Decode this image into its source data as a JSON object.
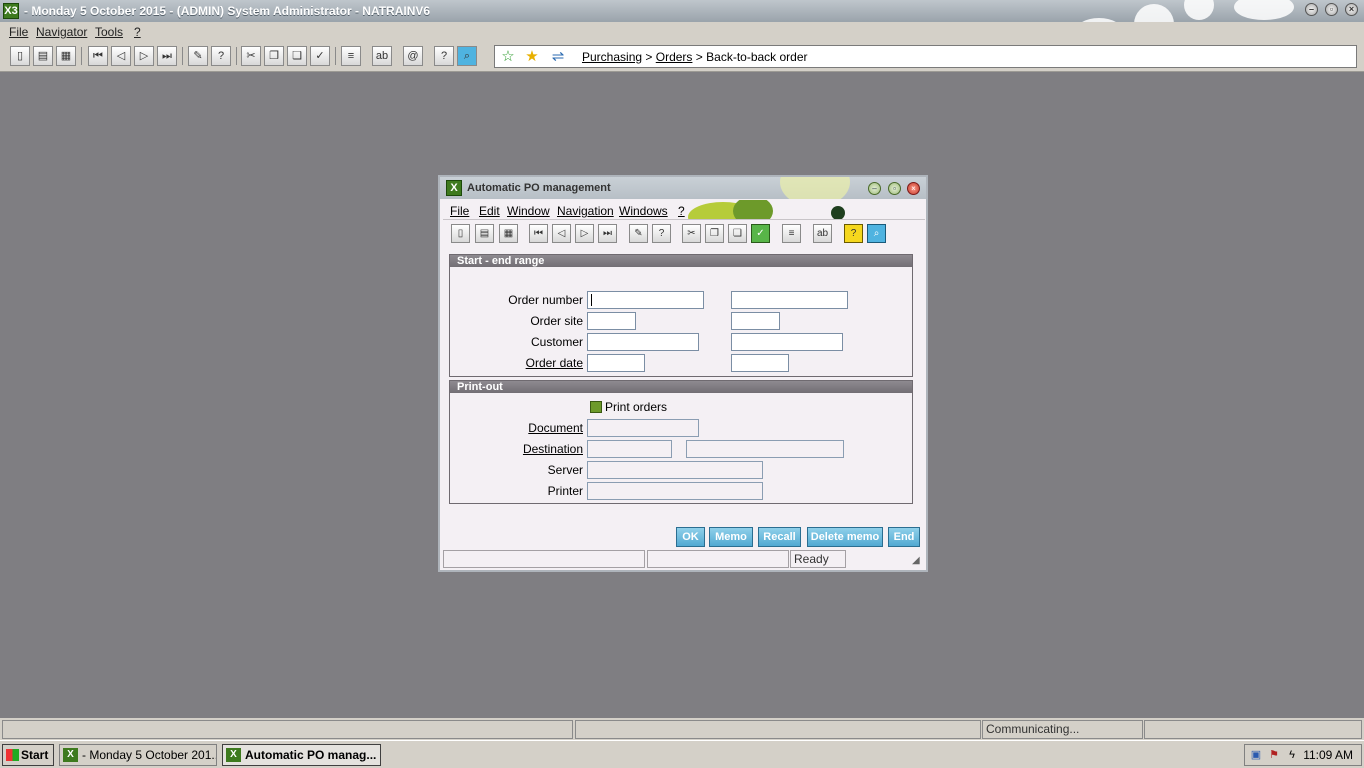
{
  "app": {
    "title": "- Monday 5 October 2015 - (ADMIN) System Administrator - NATRAINV6",
    "logo": "X3",
    "menu": [
      "File",
      "Navigator",
      "Tools",
      "?"
    ],
    "breadcrumb": {
      "items": [
        "Purchasing",
        "Orders",
        "Back-to-back order"
      ],
      "sep": ">"
    }
  },
  "window": {
    "title": "Automatic PO management",
    "menu": [
      "File",
      "Edit",
      "Window",
      "Navigation",
      "Windows",
      "?"
    ],
    "range_group": {
      "header": "Start - end range",
      "labels": {
        "order_number": "Order number",
        "order_site": "Order site",
        "customer": "Customer",
        "order_date": "Order date"
      },
      "values": {
        "order_number_from": "",
        "order_number_to": "",
        "order_site_from": "",
        "order_site_to": "",
        "customer_from": "",
        "customer_to": "",
        "order_date_from": "",
        "order_date_to": ""
      }
    },
    "print_group": {
      "header": "Print-out",
      "print_orders_label": "Print orders",
      "print_orders_checked": true,
      "labels": {
        "document": "Document",
        "destination": "Destination",
        "server": "Server",
        "printer": "Printer"
      },
      "values": {
        "document": "",
        "destination_code": "",
        "destination_desc": "",
        "server": "",
        "printer": ""
      }
    },
    "buttons": {
      "ok": "OK",
      "memo": "Memo",
      "recall": "Recall",
      "delete_memo": "Delete memo",
      "end": "End"
    },
    "status": {
      "left": "",
      "mid": "",
      "ready": "Ready"
    }
  },
  "status_bar": {
    "cell1": "",
    "cell2": "",
    "cell3": "Communicating...",
    "cell4": ""
  },
  "taskbar": {
    "start": "Start",
    "tasks": [
      "- Monday 5 October 201...",
      "Automatic PO manag..."
    ],
    "clock": "11:09 AM"
  },
  "colors": {
    "desktop": "#7f7e82",
    "accent_blue": "#52a9d2",
    "accent_green": "#6d9a2a"
  }
}
